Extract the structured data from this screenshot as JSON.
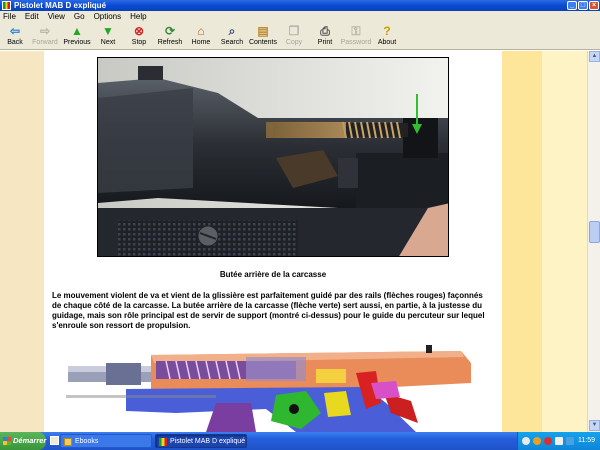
{
  "window": {
    "title": "Pistolet MAB D expliqué",
    "controls": [
      "minimize-icon",
      "maximize-icon",
      "close-icon"
    ]
  },
  "menu": [
    "File",
    "Edit",
    "View",
    "Go",
    "Options",
    "Help"
  ],
  "toolbar": {
    "back": "Back",
    "forward": "Forward",
    "previous": "Previous",
    "next": "Next",
    "stop": "Stop",
    "refresh": "Refresh",
    "home": "Home",
    "search": "Search",
    "contents": "Contents",
    "copy": "Copy",
    "print": "Print",
    "password": "Password",
    "about": "About"
  },
  "page": {
    "caption": "Butée arrière de la carcasse",
    "paragraph": "Le mouvement violent de va et vient de la glissière est parfaitement guidé par des rails (flèches rouges) façonnés de chaque côté de la carcasse. La butée arrière de la carcasse (flèche verte) sert aussi, en partie, à la justesse du guidage, mais son rôle principal est de servir de support (montré ci-dessus) pour le guide du percuteur sur lequel s'enroule son ressort de propulsion."
  },
  "colors": {
    "xp_blue": "#245edb",
    "left_strip": "#f6e7c2",
    "right_strip": "#fde59a",
    "green_arrow": "#2fbf2f"
  },
  "taskbar": {
    "start": "Démarrer",
    "items": [
      {
        "label": "Ebooks",
        "icon": "folder-icon",
        "active": false
      },
      {
        "label": "Pistolet MAB D expliqué",
        "icon": "ebook-icon",
        "active": true
      }
    ],
    "clock": "11:59"
  }
}
